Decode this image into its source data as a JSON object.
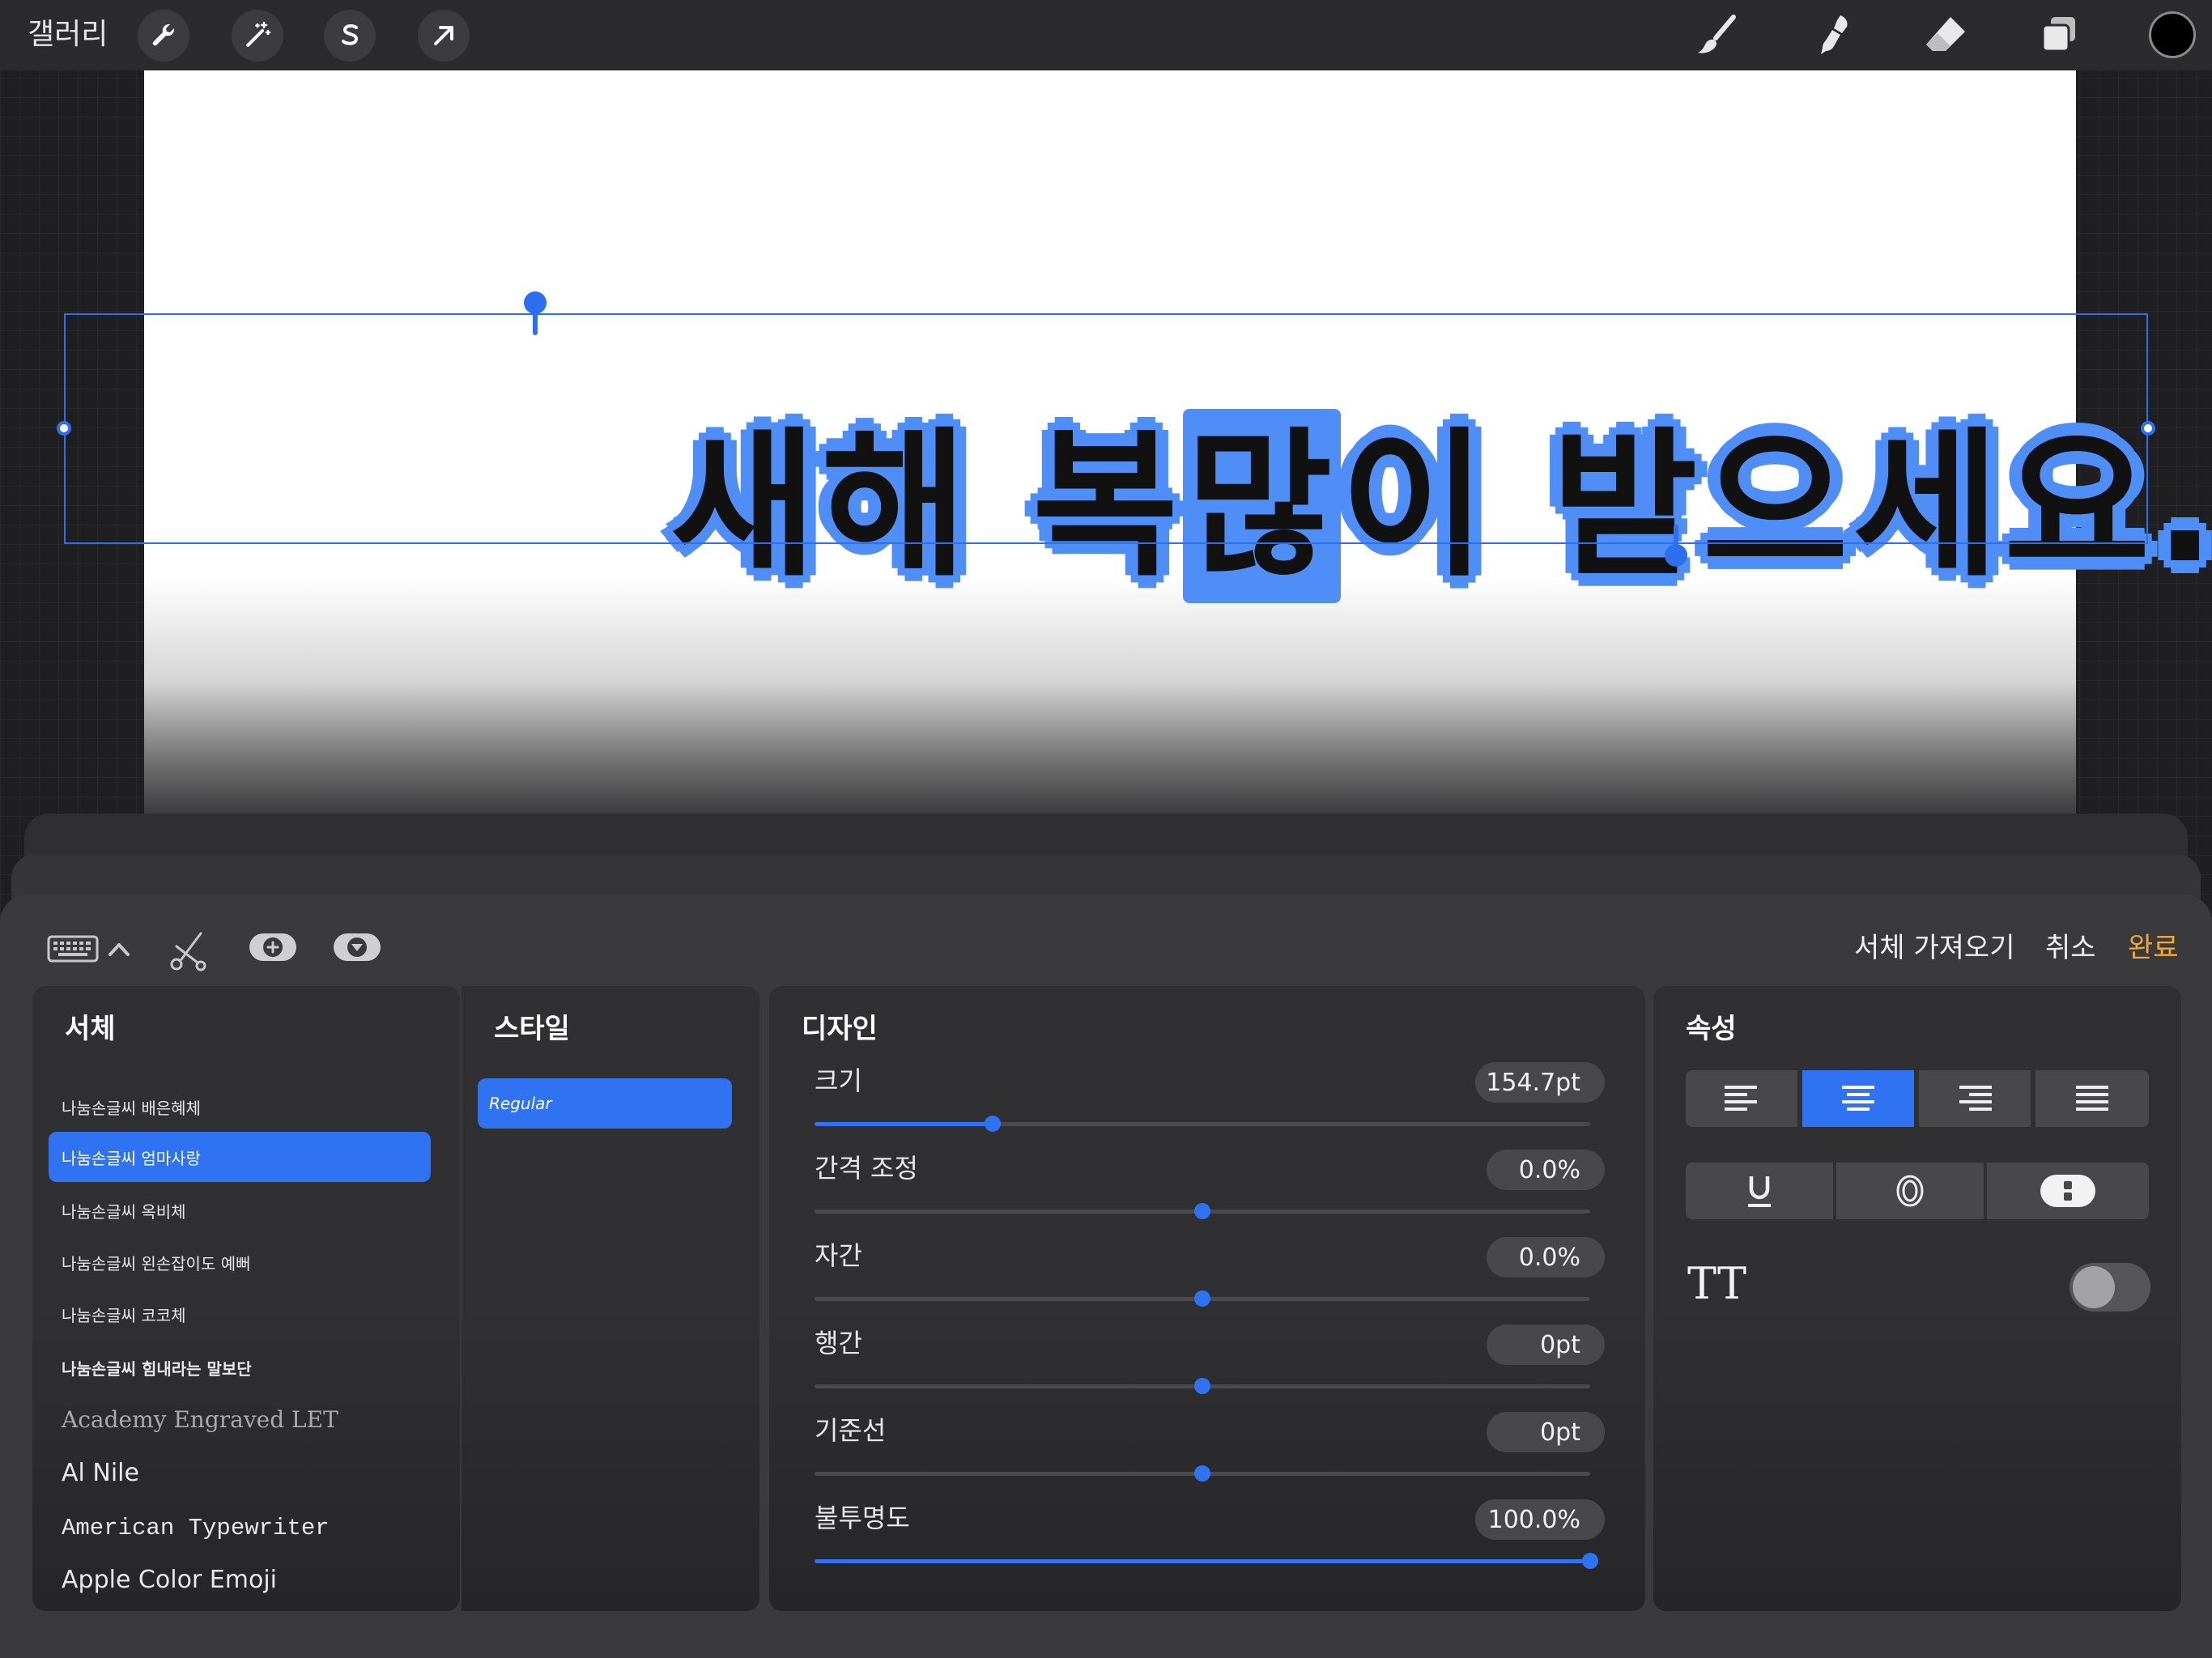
{
  "topbar": {
    "gallery_label": "갤러리",
    "left_tools": [
      "wrench-icon",
      "magic-wand-icon",
      "selection-s-icon",
      "transform-arrow-icon"
    ],
    "right_tools": [
      "brush-icon",
      "smudge-icon",
      "eraser-icon",
      "layers-icon"
    ],
    "current_color": "#000000"
  },
  "canvas": {
    "text_before": "새해 복 ",
    "text_selected": "많",
    "text_after": "이 받으세요.",
    "text_color": "#111111",
    "outline_color": "#4f8ef7",
    "selection_color": "#2e6ff0"
  },
  "toolbar": {
    "keyboard_icon": "keyboard-icon",
    "import_font_label": "서체 가져오기",
    "cancel_label": "취소",
    "done_label": "완료"
  },
  "fonts": {
    "title": "서체",
    "items": [
      "나눔손글씨 배은혜체",
      "나눔손글씨 엄마사랑",
      "나눔손글씨 옥비체",
      "나눔손글씨 왼손잡이도 예뻐",
      "나눔손글씨 코코체",
      "나눔손글씨 힘내라는 말보단",
      "Academy Engraved LET",
      "Al Nile",
      "American Typewriter",
      "Apple Color Emoji"
    ],
    "selected_index": 1
  },
  "styles": {
    "title": "스타일",
    "items": [
      "Regular"
    ]
  },
  "design": {
    "title": "디자인",
    "props": [
      {
        "label": "크기",
        "value": "154.7pt",
        "fraction": 0.23
      },
      {
        "label": "간격 조정",
        "value": "0.0%",
        "fraction": 0.5
      },
      {
        "label": "자간",
        "value": "0.0%",
        "fraction": 0.5
      },
      {
        "label": "행간",
        "value": "0pt",
        "fraction": 0.5
      },
      {
        "label": "기준선",
        "value": "0pt",
        "fraction": 0.5
      },
      {
        "label": "불투명도",
        "value": "100.0%",
        "fraction": 1.0
      }
    ]
  },
  "attributes": {
    "title": "속성",
    "alignment_options": [
      "align-left-icon",
      "align-center-icon",
      "align-right-icon",
      "align-justify-icon"
    ],
    "selected_alignment": 1,
    "style_options": [
      "underline-icon",
      "outline-icon",
      "vertical-text-icon"
    ],
    "all_caps_label": "TT",
    "all_caps_enabled": false
  }
}
